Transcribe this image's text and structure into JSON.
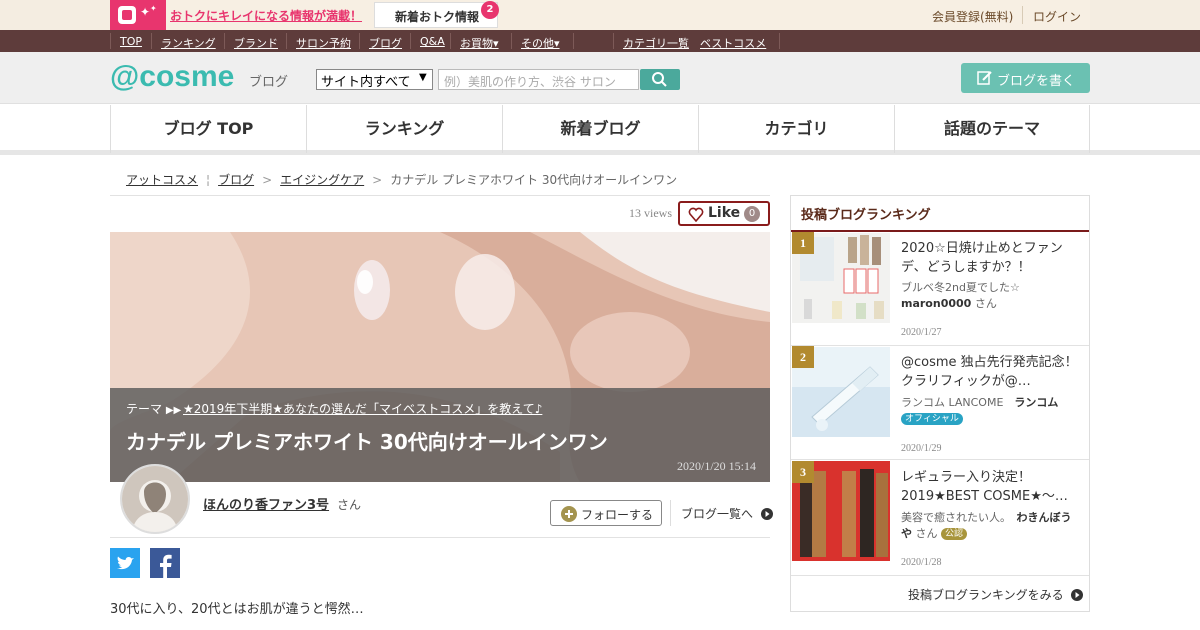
{
  "top": {
    "promo_text": "おトクにキレイになる情報が満載！",
    "new_info_label": "新着おトク情報",
    "new_info_count": "2",
    "register_label": "会員登録(無料)",
    "login_label": "ログイン"
  },
  "nav": {
    "items": [
      "TOP",
      "ランキング",
      "ブランド",
      "サロン予約",
      "ブログ",
      "Q&A",
      "お買物▾",
      "その他▾"
    ],
    "right_items": [
      "カテゴリ一覧",
      "ベストコスメ"
    ]
  },
  "header": {
    "logo": "@cosme",
    "logo_sub": "ブログ",
    "select_value": "サイト内すべて",
    "search_placeholder": "例）美肌の作り方、渋谷 サロン",
    "write_label": "ブログを書く"
  },
  "tabs": [
    "ブログ TOP",
    "ランキング",
    "新着ブログ",
    "カテゴリ",
    "話題のテーマ"
  ],
  "breadcrumb": {
    "items": [
      "アットコスメ",
      "ブログ",
      "エイジングケア"
    ],
    "current": "カナデル プレミアホワイト 30代向けオールインワン"
  },
  "post": {
    "views": "13 views",
    "like_label": "Like",
    "like_count": "0",
    "theme_label": "テーマ",
    "theme_link": "★2019年下半期★あなたの選んだ「マイベストコスメ」を教えて♪",
    "title": "カナデル プレミアホワイト 30代向けオールインワン",
    "posted_at": "2020/1/20 15:14",
    "author": "ほんのり香ファン3号",
    "author_suffix": "さん",
    "follow_label": "フォローする",
    "bloglist_label": "ブログ一覧へ",
    "body": "30代に入り、20代とはお肌が違うと愕然…"
  },
  "sidebar": {
    "title": "投稿ブログランキング",
    "items": [
      {
        "rank": "1",
        "title": "2020☆日焼け止めとファンデ、どうしますか？！",
        "desc": "ブルベ冬2nd夏でした☆",
        "author": "maron0000",
        "suffix": "さん",
        "badge": "",
        "date": "2020/1/27"
      },
      {
        "rank": "2",
        "title": "@cosme 独占先行発売記念！クラリフィックが@…",
        "desc": "ランコム LANCOME",
        "author": "ランコム",
        "suffix": "",
        "badge": "オフィシャル",
        "date": "2020/1/29"
      },
      {
        "rank": "3",
        "title": "レギュラー入り決定！2019★BEST COSME★～…",
        "desc": "美容で癒されたい人。",
        "author": "わきんぼうや",
        "suffix": "さん",
        "badge": "公認",
        "date": "2020/1/28"
      }
    ],
    "more_label": "投稿ブログランキングをみる"
  },
  "colors": {
    "accent": "#3bbbb0",
    "nav_bg": "#5e3c3b",
    "promo": "#e8356e",
    "like_border": "#8a1c1c",
    "rank_badge": "#b28a2f"
  }
}
